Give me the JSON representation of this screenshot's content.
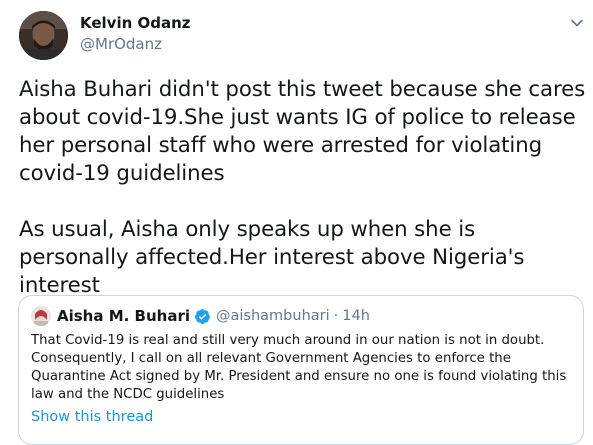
{
  "tweet": {
    "author": {
      "display_name": "Kelvin Odanz",
      "handle": "@MrOdanz"
    },
    "paragraphs": [
      "Aisha Buhari didn't post this tweet because she cares about covid-19.She just wants IG of police to release her personal staff who were arrested for violating covid-19 guidelines",
      "As usual, Aisha only speaks up when she is personally affected.Her interest above Nigeria's interest"
    ]
  },
  "quoted_tweet": {
    "display_name": "Aisha M. Buhari",
    "handle": "@aishambuhari",
    "separator": "·",
    "time": "14h",
    "text": "That Covid-19 is real and still very much around in our nation is not in doubt. Consequently, I call on all relevant Government Agencies to enforce the Quarantine Act signed by Mr. President and ensure no one is found violating this law and the NCDC guidelines",
    "show_thread_label": "Show this thread"
  },
  "icons": {
    "caret": "chevron-down-icon",
    "verified": "verified-badge-icon"
  },
  "colors": {
    "text_primary": "#14171a",
    "text_secondary": "#657786",
    "link": "#1b95e0",
    "verified": "#1da1f2",
    "border": "#ccd6dd"
  }
}
